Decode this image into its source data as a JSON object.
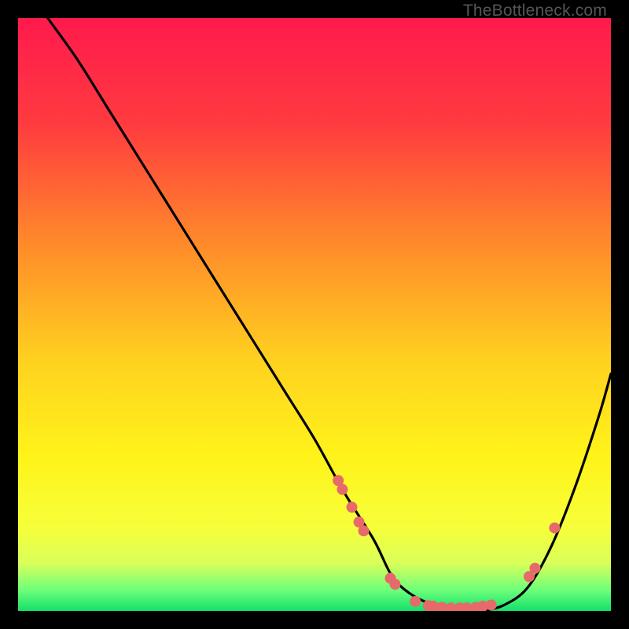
{
  "attribution": "TheBottleneck.com",
  "gradient": {
    "stops": [
      {
        "offset": 0.0,
        "color": "#ff1a4d"
      },
      {
        "offset": 0.18,
        "color": "#ff3b3f"
      },
      {
        "offset": 0.38,
        "color": "#ff8a2a"
      },
      {
        "offset": 0.58,
        "color": "#ffd21f"
      },
      {
        "offset": 0.74,
        "color": "#fff31a"
      },
      {
        "offset": 0.86,
        "color": "#f6ff3a"
      },
      {
        "offset": 0.92,
        "color": "#d8ff5a"
      },
      {
        "offset": 0.965,
        "color": "#6dff7a"
      },
      {
        "offset": 1.0,
        "color": "#14e06b"
      }
    ]
  },
  "chart_data": {
    "type": "line",
    "title": "",
    "xlabel": "",
    "ylabel": "",
    "xlim": [
      0,
      100
    ],
    "ylim": [
      0,
      100
    ],
    "note": "y is bottleneck percentage; 0 = no bottleneck (bottom), 100 = full bottleneck (top). x is relative hardware scale. Values read from curve position against plot box.",
    "series": [
      {
        "name": "bottleneck-curve",
        "x": [
          5,
          10,
          15,
          20,
          25,
          30,
          35,
          40,
          45,
          50,
          55,
          60,
          63,
          66,
          70,
          74,
          78,
          82,
          86,
          90,
          94,
          98,
          100
        ],
        "y": [
          100,
          93,
          85,
          77,
          69,
          61,
          53,
          45,
          37,
          29,
          20,
          12,
          6,
          3,
          1,
          0,
          0,
          1,
          4,
          11,
          21,
          33,
          40
        ]
      }
    ],
    "markers": {
      "name": "highlighted-points",
      "color": "#e66a6a",
      "x": [
        54.0,
        54.7,
        56.3,
        57.5,
        58.3,
        62.8,
        63.6,
        67.0,
        69.2,
        70.0,
        71.5,
        73.0,
        74.5,
        75.7,
        77.2,
        78.4,
        79.8,
        86.2,
        87.2,
        90.5
      ],
      "y": [
        22.0,
        20.5,
        17.5,
        15.0,
        13.5,
        5.5,
        4.5,
        1.6,
        0.9,
        0.8,
        0.6,
        0.5,
        0.5,
        0.5,
        0.6,
        0.8,
        1.0,
        5.8,
        7.2,
        14.0
      ]
    }
  }
}
